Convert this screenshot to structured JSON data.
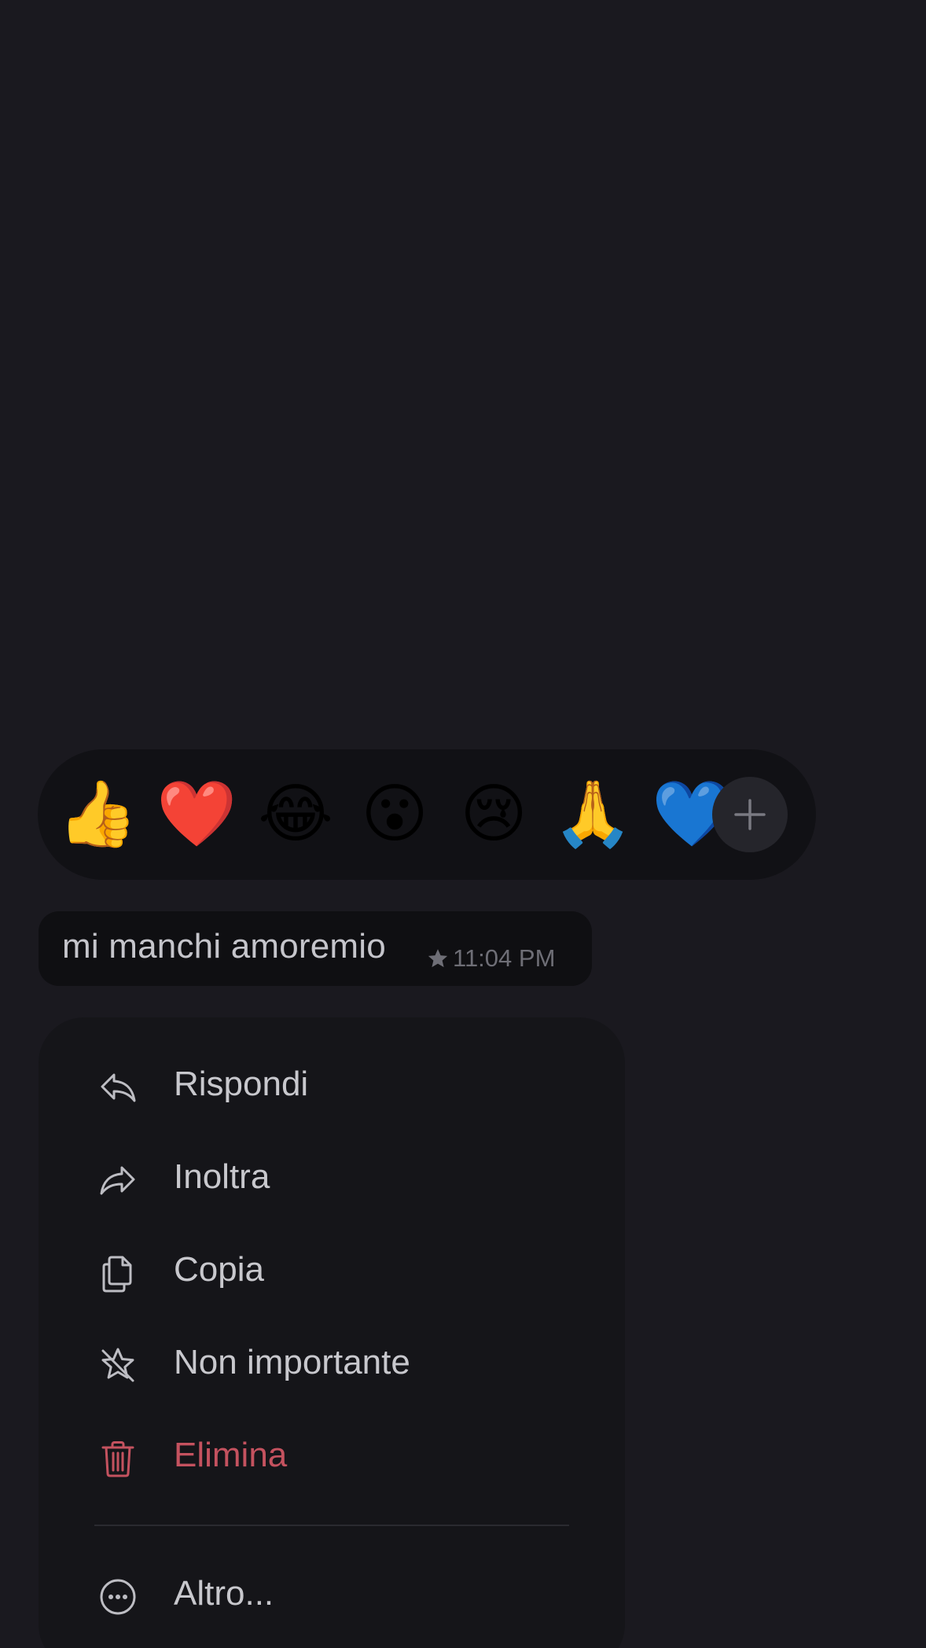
{
  "reactions": [
    {
      "emoji": "👍",
      "name": "thumbs-up"
    },
    {
      "emoji": "❤️",
      "name": "red-heart"
    },
    {
      "emoji": "😂",
      "name": "tears-of-joy"
    },
    {
      "emoji": "😮",
      "name": "surprised-face"
    },
    {
      "emoji": "😢",
      "name": "crying-face"
    },
    {
      "emoji": "🙏",
      "name": "folded-hands"
    },
    {
      "emoji": "💙",
      "name": "blue-heart"
    }
  ],
  "reaction_more_icon": "plus-icon",
  "message": {
    "text": "mi manchi amoremio",
    "starred_icon": "star-icon",
    "time": "11:04 PM"
  },
  "menu": {
    "reply": {
      "label": "Rispondi",
      "icon": "reply-icon"
    },
    "forward": {
      "label": "Inoltra",
      "icon": "forward-icon"
    },
    "copy": {
      "label": "Copia",
      "icon": "copy-icon"
    },
    "unstar": {
      "label": "Non importante",
      "icon": "star-off-icon"
    },
    "delete": {
      "label": "Elimina",
      "icon": "trash-icon"
    },
    "more": {
      "label": "Altro...",
      "icon": "more-icon"
    }
  },
  "colors": {
    "background": "#1a191f",
    "danger": "#c4525f",
    "text": "#c8c8cd",
    "muted": "#6e6e76"
  }
}
